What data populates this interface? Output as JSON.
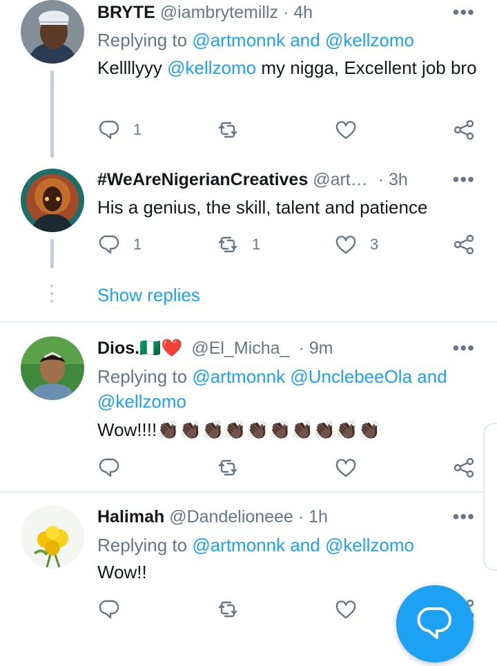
{
  "tweets": [
    {
      "name": "BRYTE",
      "handle": "@iambrytemillz",
      "time": "4h",
      "replying_prefix": "Replying to",
      "replying_links": [
        "@artmonnk",
        "and",
        "@kellzomo"
      ],
      "text_before_link": "Kellllyyy",
      "text_link": "@kellzomo",
      "text_after_link": "my nigga,  Excellent job bro",
      "reply_count": "1",
      "retweet_count": "",
      "like_count": ""
    },
    {
      "name": "#WeAreNigerianCreatives",
      "handle": "@art…",
      "time": "3h",
      "text": "His a genius, the skill, talent and patience",
      "reply_count": "1",
      "retweet_count": "1",
      "like_count": "3"
    },
    {
      "name": "Dios.🇳🇬❤️",
      "handle": "@El_Micha_",
      "time": "9m",
      "replying_prefix": "Replying to",
      "replying_line1": [
        "@artmonnk",
        "@UnclebeeOla",
        "and"
      ],
      "replying_line2": "@kellzomo",
      "text": "Wow!!!!👏🏿👏🏿👏🏿👏🏿👏🏿👏🏿👏🏿👏🏿👏🏿👏🏿",
      "reply_count": "",
      "retweet_count": "",
      "like_count": ""
    },
    {
      "name": "Halimah",
      "handle": "@Dandelioneee",
      "time": "1h",
      "replying_prefix": "Replying to",
      "replying_links": [
        "@artmonnk",
        "and",
        "@kellzomo"
      ],
      "text": "Wow!!",
      "reply_count": "",
      "retweet_count": "",
      "like_count": ""
    }
  ],
  "show_replies_label": "Show replies",
  "more_glyph": "•••",
  "separator": "·",
  "colors": {
    "link": "#1da1f2",
    "muted": "#657786",
    "fab": "#1da1f2",
    "thread": "#c4cfd6"
  },
  "icons": [
    "reply-icon",
    "retweet-icon",
    "like-icon",
    "share-icon",
    "compose-reply-icon",
    "more-icon"
  ]
}
